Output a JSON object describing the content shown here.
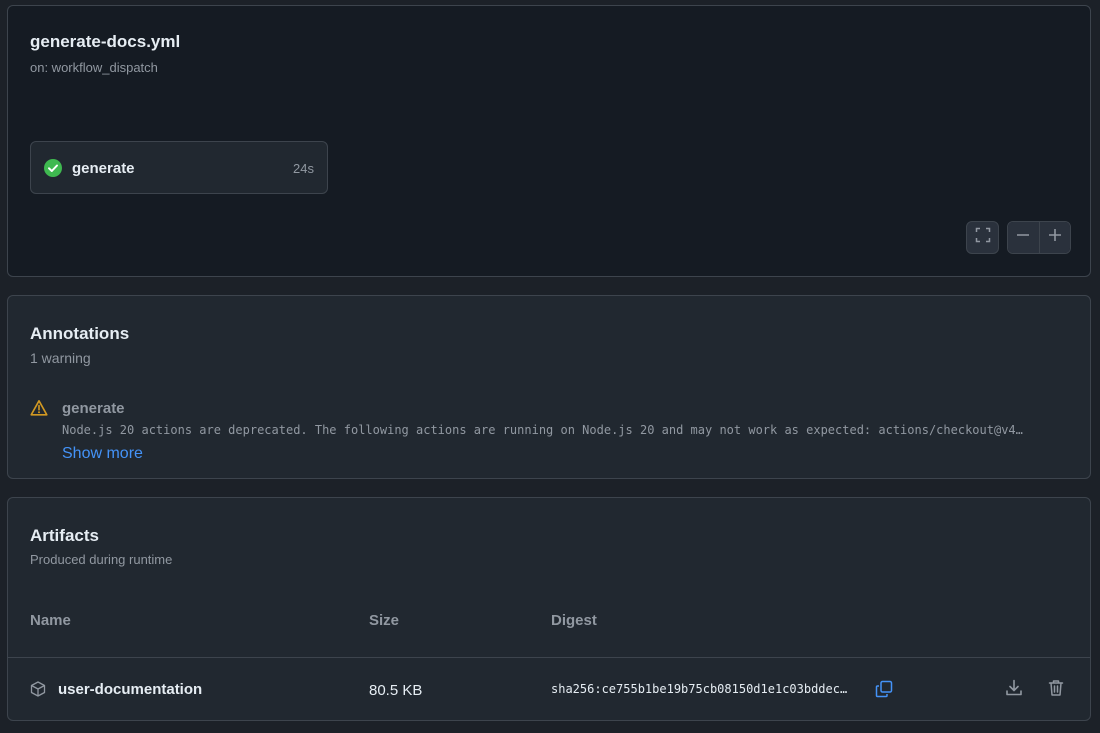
{
  "workflow": {
    "title": "generate-docs.yml",
    "trigger": "on: workflow_dispatch",
    "job": {
      "name": "generate",
      "duration": "24s",
      "status": "success"
    }
  },
  "annotations": {
    "title": "Annotations",
    "count_label": "1 warning",
    "items": [
      {
        "level": "warning",
        "job": "generate",
        "message": "Node.js 20 actions are deprecated. The following actions are running on Node.js 20 and may not work as expected: actions/checkout@v4…",
        "show_more": "Show more"
      }
    ]
  },
  "artifacts": {
    "title": "Artifacts",
    "subtitle": "Produced during runtime",
    "columns": {
      "name": "Name",
      "size": "Size",
      "digest": "Digest"
    },
    "rows": [
      {
        "name": "user-documentation",
        "size": "80.5 KB",
        "digest": "sha256:ce755b1be19b75cb08150d1e1c03bddec…"
      }
    ]
  },
  "colors": {
    "success": "#3fb950",
    "warning": "#d29922",
    "link": "#4493f8"
  },
  "icons": [
    "check-circle-icon",
    "fullscreen-icon",
    "zoom-out-icon",
    "zoom-in-icon",
    "alert-icon",
    "package-icon",
    "copy-icon",
    "download-icon",
    "trash-icon"
  ]
}
